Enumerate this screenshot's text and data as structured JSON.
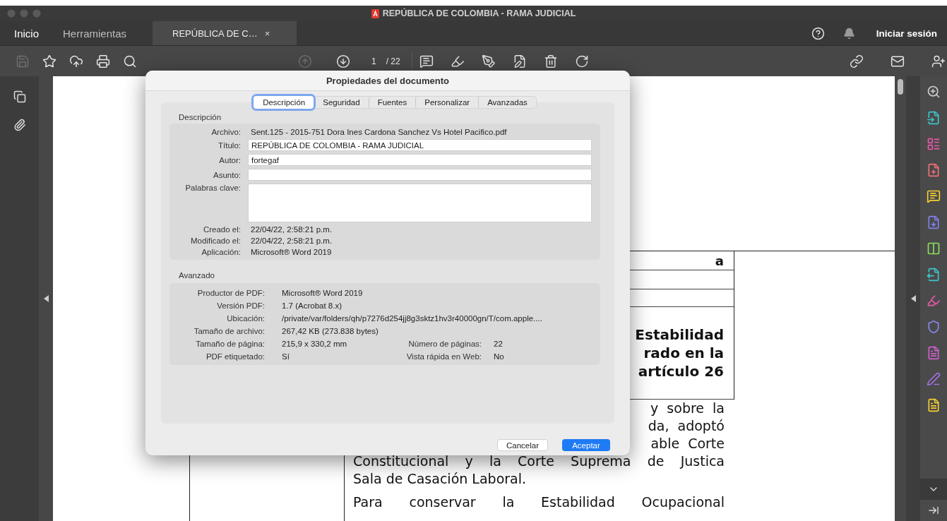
{
  "window": {
    "title": "REPÚBLICA DE COLOMBIA - RAMA JUDICIAL"
  },
  "nav": [
    {
      "label": "Inicio",
      "selected": true
    },
    {
      "label": "Herramientas",
      "selected": false
    }
  ],
  "doc_tab": {
    "label": "REPÚBLICA DE C…",
    "close": "×"
  },
  "sign_in": "Iniciar sesión",
  "toolbar": {
    "left": [
      {
        "kind": "save",
        "disabled": true
      },
      {
        "kind": "star",
        "disabled": false
      },
      {
        "kind": "upload",
        "disabled": false
      },
      {
        "kind": "print",
        "disabled": false
      },
      {
        "kind": "find",
        "disabled": false
      }
    ],
    "nav": [
      {
        "kind": "prev",
        "disabled": true
      },
      {
        "kind": "next",
        "disabled": false
      }
    ],
    "page": "1",
    "page_total": "/ 22",
    "tools": [
      {
        "kind": "comment",
        "disabled": false
      },
      {
        "kind": "highlight",
        "disabled": false
      },
      {
        "kind": "sign",
        "disabled": false
      },
      {
        "kind": "edit",
        "disabled": false
      },
      {
        "kind": "delete",
        "disabled": false
      },
      {
        "kind": "rotate",
        "disabled": false
      }
    ],
    "right": [
      {
        "kind": "link",
        "disabled": false
      },
      {
        "kind": "mail",
        "disabled": false
      },
      {
        "kind": "adduser",
        "disabled": false
      }
    ]
  },
  "document": {
    "table_cell": "a",
    "heading_lines": [
      "Estabilidad",
      "rado en la",
      "artículo 26"
    ],
    "fragment_lines": [
      "y sobre la",
      "da, adoptó",
      "able Corte"
    ],
    "lines": [
      {
        "text": "Constitucional y la Corte Suprema de Justica",
        "last": false
      },
      {
        "text": "Sala de Casación Laboral.",
        "last": true
      },
      {
        "text": "Para conservar la Estabilidad Ocupacional",
        "last": false
      }
    ]
  },
  "dialog": {
    "title": "Propiedades del documento",
    "tabs": [
      {
        "label": "Descripción",
        "selected": true
      },
      {
        "label": "Seguridad",
        "selected": false
      },
      {
        "label": "Fuentes",
        "selected": false
      },
      {
        "label": "Personalizar",
        "selected": false
      },
      {
        "label": "Avanzadas",
        "selected": false
      }
    ],
    "description": {
      "heading": "Descripción",
      "rows": [
        {
          "kind": "text",
          "label": "Archivo:",
          "value": "Sent.125 - 2015-751 Dora Ines Cardona Sanchez Vs Hotel Pacifico.pdf"
        },
        {
          "kind": "field",
          "label": "Título:",
          "value": "REPÚBLICA DE COLOMBIA - RAMA JUDICIAL"
        },
        {
          "kind": "field",
          "label": "Autor:",
          "value": "fortegaf"
        },
        {
          "kind": "field",
          "label": "Asunto:"
        },
        {
          "kind": "area",
          "label": "Palabras clave:"
        },
        {
          "kind": "text",
          "label": "Creado el:",
          "value": "22/04/22, 2:58:21 p.m."
        },
        {
          "kind": "text",
          "label": "Modificado el:",
          "value": "22/04/22, 2:58:21 p.m."
        },
        {
          "kind": "text",
          "label": "Aplicación:",
          "value": "Microsoft® Word 2019"
        }
      ]
    },
    "advanced": {
      "heading": "Avanzado",
      "rows": [
        {
          "label": "Productor de PDF:",
          "value": "Microsoft® Word 2019"
        },
        {
          "label": "Versión PDF:",
          "value": "1.7 (Acrobat 8.x)"
        },
        {
          "label": "Ubicación:",
          "value": "/private/var/folders/qh/p7276d254jj8g3sktz1hv3r40000gn/T/com.apple...."
        },
        {
          "label": "Tamaño de archivo:",
          "value": "267,42 KB (273.838 bytes)"
        },
        {
          "label": "Tamaño de página:",
          "value": "215,9 x 330,2 mm",
          "label_2": "Número de páginas:",
          "value_2": "22"
        },
        {
          "label": "PDF etiquetado:",
          "value": "Sí",
          "label_2": "Vista rápida en Web:",
          "value_2": "No"
        }
      ]
    },
    "buttons": [
      {
        "label": "Cancelar",
        "kind": "secondary"
      },
      {
        "label": "Aceptar",
        "kind": "primary"
      }
    ]
  }
}
